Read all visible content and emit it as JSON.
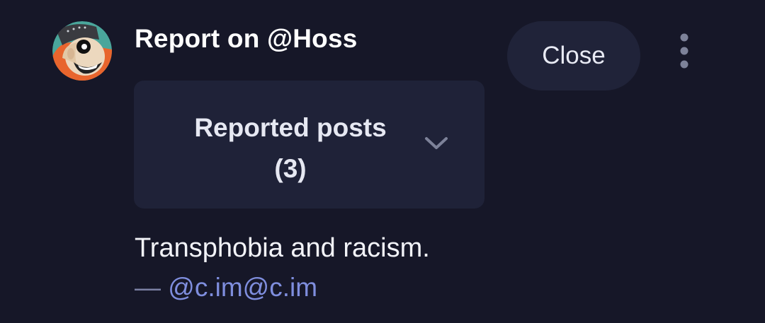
{
  "report": {
    "title": "Report on @Hoss",
    "close_label": "Close",
    "reported_posts_label": "Reported posts",
    "reported_posts_count": "(3)",
    "comment": "Transphobia and racism.",
    "attribution_dash": "—",
    "author": "@c.im@c.im"
  },
  "icons": {
    "more": "vertical-ellipsis-icon",
    "chevron": "chevron-down-icon"
  },
  "colors": {
    "background": "#161728",
    "panel": "#1f2238",
    "button": "#202339",
    "link": "#7f8ede",
    "muted": "#7b80a3"
  }
}
